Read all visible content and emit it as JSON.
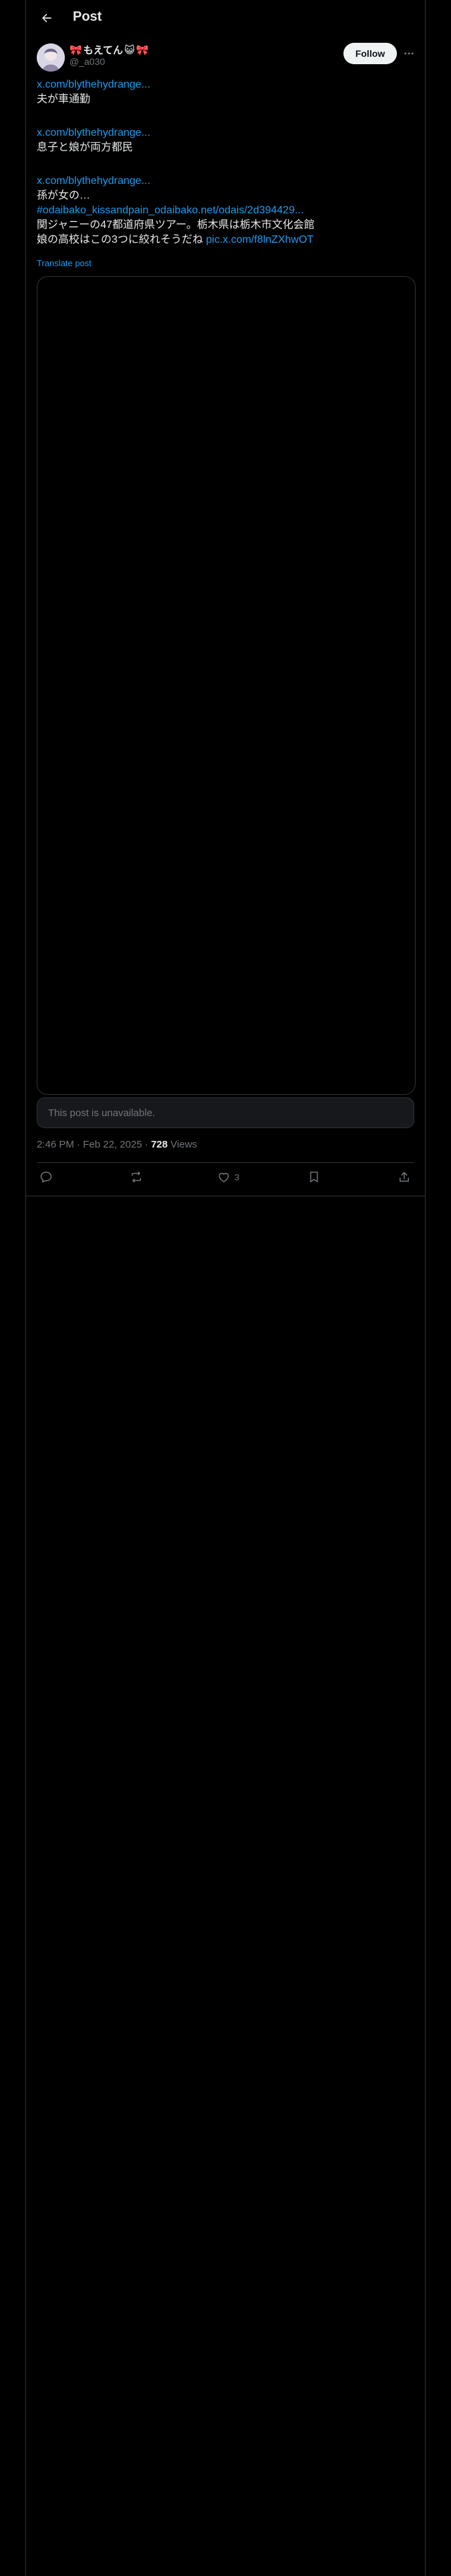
{
  "header": {
    "title": "Post",
    "back_icon": "arrow-left-icon"
  },
  "author": {
    "display_name": "もえてん",
    "handle": "@_a030",
    "follow_label": "Follow",
    "more_icon": "more-horizontal-icon",
    "name_emoji_left": "🎀",
    "name_emoji_cat": "😺",
    "name_emoji_right": "🎀"
  },
  "post": {
    "link1": "x.com/blythehydrange...",
    "text1": "夫が車通勤",
    "link2": "x.com/blythehydrange...",
    "text2": "息子と娘が両方都民",
    "link3": "x.com/blythehydrange...",
    "text3": "孫が女の…",
    "hashtag_link": "#odaibako_kissandpain_odaibako.net/odais/2d394429...",
    "text4": "関ジャニーの47都道府県ツアー。栃木県は栃木市文化会館",
    "text5": "娘の高校はこの3つに絞れそうだね",
    "pic_link": "pic.x.com/f8lnZXhwOT",
    "translate_label": "Translate post"
  },
  "quoted": {
    "unavailable_text": "This post is unavailable."
  },
  "meta": {
    "time": "2:46 PM",
    "separator": "·",
    "date": "Feb 22, 2025",
    "views_count": "728",
    "views_label": "Views"
  },
  "actions": {
    "reply_icon": "reply-icon",
    "repost_icon": "repost-icon",
    "like_icon": "heart-icon",
    "like_count": "3",
    "bookmark_icon": "bookmark-icon",
    "share_icon": "share-icon"
  },
  "colors": {
    "background": "#000000",
    "text": "#e7e9ea",
    "secondary": "#71767b",
    "link": "#1d9bf0",
    "border": "#2f3336"
  }
}
